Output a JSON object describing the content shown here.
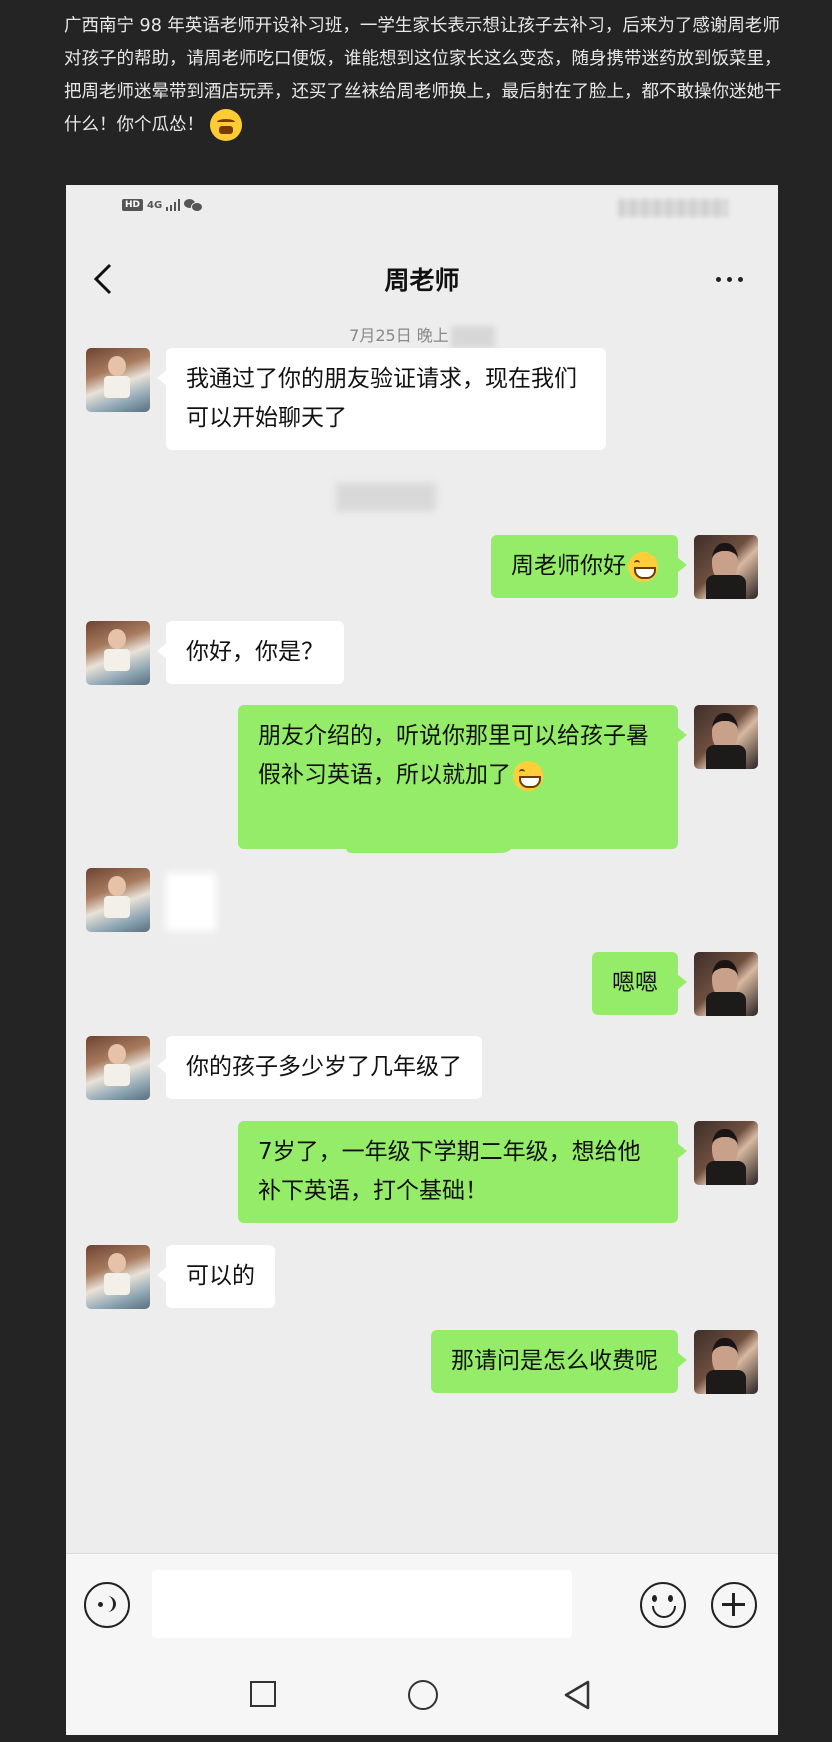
{
  "caption": {
    "text": "广西南宁 98 年英语老师开设补习班，一学生家长表示想让孩子去补习，后来为了感谢周老师对孩子的帮助，请周老师吃口便饭，谁能想到这位家长这么变态，随身携带迷药放到饭菜里，把周老师迷晕带到酒店玩弄，还买了丝袜给周老师换上，最后射在了脸上，都不敢操你迷她干什么！你个瓜怂！",
    "emoji": "angry-face-icon"
  },
  "statusbar": {
    "hd": "HD",
    "network": "4G"
  },
  "chat": {
    "title": "周老师",
    "timestamp": "7月25日 晚上"
  },
  "messages": [
    {
      "side": "left",
      "text": "我通过了你的朋友验证请求，现在我们可以开始聊天了"
    },
    {
      "side": "right",
      "text": "周老师你好",
      "emoji": "grin"
    },
    {
      "side": "left",
      "text": "你好，你是？"
    },
    {
      "side": "right",
      "text": "朋友介绍的，听说你那里可以给孩子暑假补习英语，所以就加了",
      "emoji": "grin"
    },
    {
      "side": "left",
      "text": ""
    },
    {
      "side": "right",
      "text": "嗯嗯"
    },
    {
      "side": "left",
      "text": "你的孩子多少岁了几年级了"
    },
    {
      "side": "right",
      "text": "7岁了，一年级下学期二年级，想给他补下英语，打个基础！"
    },
    {
      "side": "left",
      "text": "可以的"
    },
    {
      "side": "right",
      "text": "那请问是怎么收费呢"
    }
  ],
  "input": {
    "placeholder": ""
  },
  "colors": {
    "page_bg": "#242424",
    "chat_bg": "#ededed",
    "own_bubble": "#95ec69",
    "other_bubble": "#ffffff"
  }
}
